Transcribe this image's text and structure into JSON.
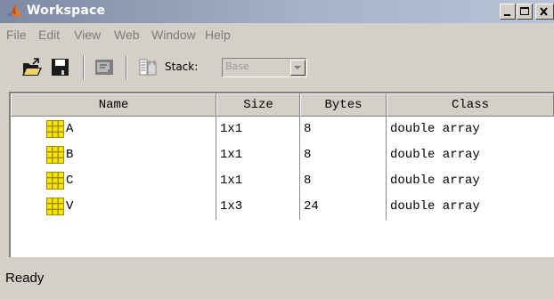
{
  "window": {
    "title": "Workspace"
  },
  "menu": {
    "items": [
      {
        "label": "File"
      },
      {
        "label": "Edit"
      },
      {
        "label": "View"
      },
      {
        "label": "Web"
      },
      {
        "label": "Window"
      },
      {
        "label": "Help"
      }
    ]
  },
  "toolbar": {
    "stack_label": "Stack:",
    "stack_value": "Base",
    "icons": [
      "open-folder-icon",
      "save-icon",
      "delete-icon",
      "import-data-icon"
    ]
  },
  "table": {
    "headers": {
      "name": "Name",
      "size": "Size",
      "bytes": "Bytes",
      "class": "Class"
    },
    "rows": [
      {
        "name": "A",
        "size": "1x1",
        "bytes": "8",
        "class": "double array"
      },
      {
        "name": "B",
        "size": "1x1",
        "bytes": "8",
        "class": "double array"
      },
      {
        "name": "C",
        "size": "1x1",
        "bytes": "8",
        "class": "double array"
      },
      {
        "name": "V",
        "size": "1x3",
        "bytes": "24",
        "class": "double array"
      }
    ]
  },
  "status": {
    "text": "Ready"
  },
  "colors": {
    "titlebar_start": "#7e8aa4",
    "titlebar_end": "#b9c3d6",
    "face": "#d4d0c8",
    "matrix_icon": "#f5e600",
    "menu_disabled": "#7c7c7c"
  }
}
